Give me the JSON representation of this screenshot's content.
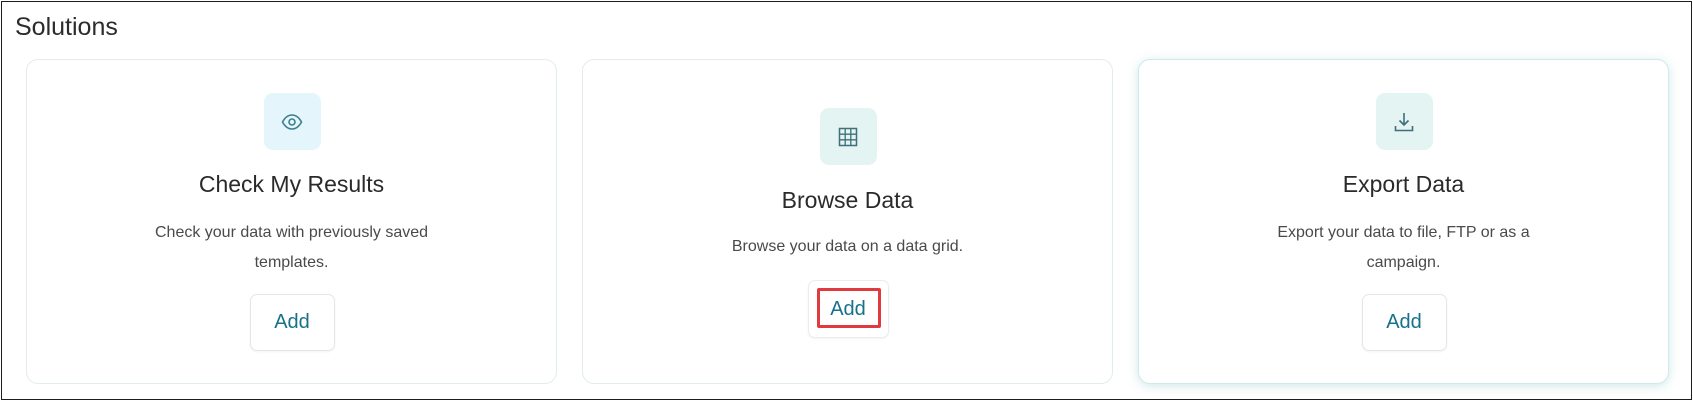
{
  "section": {
    "title": "Solutions"
  },
  "cards": [
    {
      "icon": "eye-icon",
      "title": "Check My Results",
      "description": "Check your data with previously saved templates.",
      "button_label": "Add"
    },
    {
      "icon": "table-grid-icon",
      "title": "Browse Data",
      "description": "Browse your data on a data grid.",
      "button_label": "Add",
      "button_highlighted": true
    },
    {
      "icon": "download-icon",
      "title": "Export Data",
      "description": "Export your data to file, FTP or as a campaign.",
      "button_label": "Add"
    }
  ],
  "colors": {
    "accent": "#17718a",
    "highlight": "#e0393e",
    "icon_bg_blue": "#e4f6fb",
    "icon_bg_teal": "#e3f4f2"
  }
}
